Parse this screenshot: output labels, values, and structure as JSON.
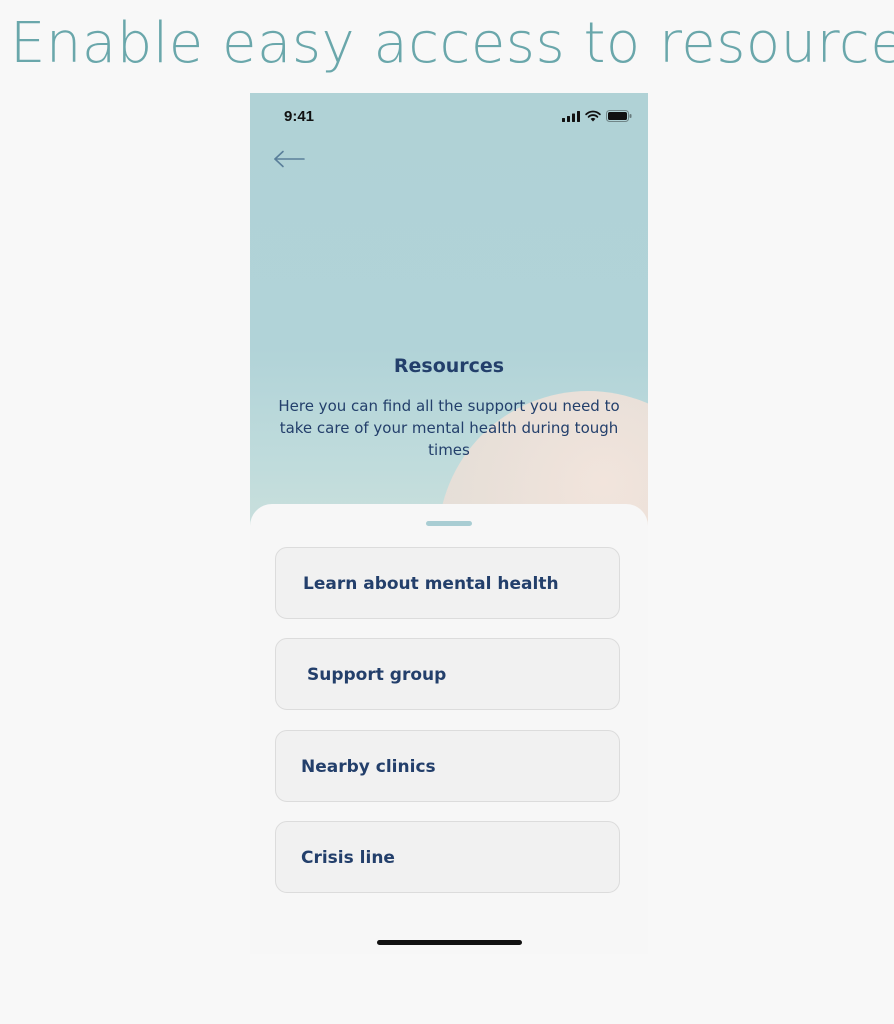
{
  "slide": {
    "title": "Enable easy access to resources"
  },
  "status_bar": {
    "time": "9:41",
    "icons": [
      "cellular-signal-icon",
      "wifi-icon",
      "battery-icon"
    ]
  },
  "header": {
    "back_icon": "arrow-left-icon"
  },
  "hero": {
    "title": "Resources",
    "description": "Here you can find all the support you need to take care of your mental health during tough times"
  },
  "options": [
    {
      "label": "Learn about mental health"
    },
    {
      "label": "Support group"
    },
    {
      "label": "Nearby clinics"
    },
    {
      "label": "Crisis line"
    }
  ],
  "colors": {
    "title_teal": "#6aa7ab",
    "hero_bg": "#b0d2d6",
    "text_navy": "#233f6b",
    "card_bg": "#f1f1f1",
    "grabber": "#a9cdd3"
  }
}
